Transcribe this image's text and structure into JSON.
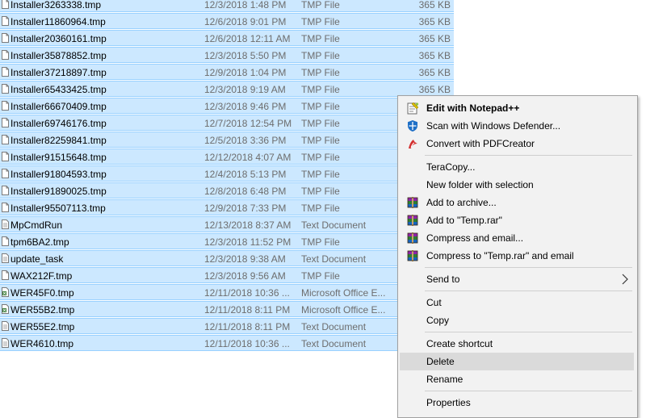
{
  "files": [
    {
      "name": "Installer3263338.tmp",
      "date": "12/3/2018 1:48 PM",
      "type": "TMP File",
      "size": "365 KB",
      "icon": "file-icon"
    },
    {
      "name": "Installer11860964.tmp",
      "date": "12/6/2018 9:01 PM",
      "type": "TMP File",
      "size": "365 KB",
      "icon": "file-icon"
    },
    {
      "name": "Installer20360161.tmp",
      "date": "12/6/2018 12:11 AM",
      "type": "TMP File",
      "size": "365 KB",
      "icon": "file-icon"
    },
    {
      "name": "Installer35878852.tmp",
      "date": "12/3/2018 5:50 PM",
      "type": "TMP File",
      "size": "365 KB",
      "icon": "file-icon"
    },
    {
      "name": "Installer37218897.tmp",
      "date": "12/9/2018 1:04 PM",
      "type": "TMP File",
      "size": "365 KB",
      "icon": "file-icon"
    },
    {
      "name": "Installer65433425.tmp",
      "date": "12/3/2018 9:19 AM",
      "type": "TMP File",
      "size": "365 KB",
      "icon": "file-icon"
    },
    {
      "name": "Installer66670409.tmp",
      "date": "12/3/2018 9:46 PM",
      "type": "TMP File",
      "size": "",
      "icon": "file-icon"
    },
    {
      "name": "Installer69746176.tmp",
      "date": "12/7/2018 12:54 PM",
      "type": "TMP File",
      "size": "",
      "icon": "file-icon"
    },
    {
      "name": "Installer82259841.tmp",
      "date": "12/5/2018 3:36 PM",
      "type": "TMP File",
      "size": "",
      "icon": "file-icon"
    },
    {
      "name": "Installer91515648.tmp",
      "date": "12/12/2018 4:07 AM",
      "type": "TMP File",
      "size": "",
      "icon": "file-icon"
    },
    {
      "name": "Installer91804593.tmp",
      "date": "12/4/2018 5:13 PM",
      "type": "TMP File",
      "size": "",
      "icon": "file-icon"
    },
    {
      "name": "Installer91890025.tmp",
      "date": "12/8/2018 6:48 PM",
      "type": "TMP File",
      "size": "",
      "icon": "file-icon"
    },
    {
      "name": "Installer95507113.tmp",
      "date": "12/9/2018 7:33 PM",
      "type": "TMP File",
      "size": "",
      "icon": "file-icon"
    },
    {
      "name": "MpCmdRun",
      "date": "12/13/2018 8:37 AM",
      "type": "Text Document",
      "size": "",
      "icon": "text-file-icon"
    },
    {
      "name": "tpm6BA2.tmp",
      "date": "12/3/2018 11:52 PM",
      "type": "TMP File",
      "size": "",
      "icon": "file-icon"
    },
    {
      "name": "update_task",
      "date": "12/3/2018 9:38 AM",
      "type": "Text Document",
      "size": "",
      "icon": "text-file-icon"
    },
    {
      "name": "WAX212F.tmp",
      "date": "12/3/2018 9:56 AM",
      "type": "TMP File",
      "size": "",
      "icon": "file-icon"
    },
    {
      "name": "WER45F0.tmp",
      "date": "12/11/2018 10:36 ...",
      "type": "Microsoft Office E...",
      "size": "",
      "icon": "office-file-icon"
    },
    {
      "name": "WER55B2.tmp",
      "date": "12/11/2018 8:11 PM",
      "type": "Microsoft Office E...",
      "size": "",
      "icon": "office-file-icon"
    },
    {
      "name": "WER55E2.tmp",
      "date": "12/11/2018 8:11 PM",
      "type": "Text Document",
      "size": "",
      "icon": "text-file-icon"
    },
    {
      "name": "WER4610.tmp",
      "date": "12/11/2018 10:36 ...",
      "type": "Text Document",
      "size": "",
      "icon": "text-file-icon"
    }
  ],
  "context_menu": {
    "items": [
      {
        "label": "Edit with Notepad++",
        "icon": "notepad-plus-plus-icon",
        "bold": true
      },
      {
        "label": "Scan with Windows Defender...",
        "icon": "windows-defender-icon"
      },
      {
        "label": "Convert with PDFCreator",
        "icon": "pdfcreator-icon"
      },
      {
        "separator": true
      },
      {
        "label": "TeraCopy...",
        "icon": ""
      },
      {
        "label": "New folder with selection",
        "icon": ""
      },
      {
        "label": "Add to archive...",
        "icon": "winrar-icon"
      },
      {
        "label": "Add to \"Temp.rar\"",
        "icon": "winrar-icon"
      },
      {
        "label": "Compress and email...",
        "icon": "winrar-icon"
      },
      {
        "label": "Compress to \"Temp.rar\" and email",
        "icon": "winrar-icon"
      },
      {
        "separator": true
      },
      {
        "label": "Send to",
        "icon": "",
        "submenu": true
      },
      {
        "separator": true
      },
      {
        "label": "Cut",
        "icon": ""
      },
      {
        "label": "Copy",
        "icon": ""
      },
      {
        "separator": true
      },
      {
        "label": "Create shortcut",
        "icon": ""
      },
      {
        "label": "Delete",
        "icon": "",
        "hover": true
      },
      {
        "label": "Rename",
        "icon": ""
      },
      {
        "separator": true
      },
      {
        "label": "Properties",
        "icon": ""
      }
    ]
  },
  "colors": {
    "selection_bg": "#cce8ff",
    "selection_border": "#99d1ff",
    "menu_bg": "#f2f2f2",
    "menu_hover": "#dadada"
  }
}
